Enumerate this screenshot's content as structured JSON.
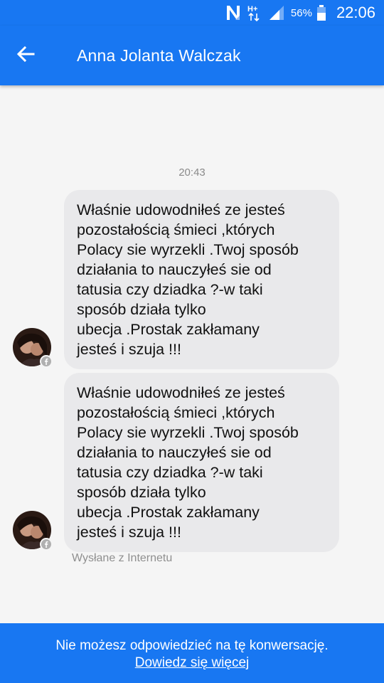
{
  "status_bar": {
    "carrier_icon": "n-icon",
    "network_label": "H+",
    "battery_percent": "56%",
    "time": "22:06"
  },
  "header": {
    "back_icon": "arrow-back-icon",
    "title": "Anna Jolanta Walczak"
  },
  "conversation": {
    "timestamp": "20:43",
    "messages": [
      {
        "text": "Właśnie udowodniłeś ze jesteś\npozostałością śmieci ,których\nPolacy sie wyrzekli .Twoj sposób\ndziałania to nauczyłeś sie od\ntatusia czy dziadka ?-w taki\nsposób działa tylko\nubecja .Prostak zakłamany\njesteś i szuja !!!"
      },
      {
        "text": "Właśnie udowodniłeś ze jesteś\npozostałością śmieci ,których\nPolacy sie wyrzekli .Twoj sposób\ndziałania to nauczyłeś sie od\ntatusia czy dziadka ?-w taki\nsposób działa tylko\nubecja .Prostak zakłamany\njesteś i szuja !!!"
      }
    ],
    "sent_from": "Wysłane z Internetu"
  },
  "footer": {
    "notice": "Nie możesz odpowiedzieć na tę konwersację.",
    "learn_more": "Dowiedz się więcej"
  },
  "colors": {
    "brand_blue": "#1877f2",
    "bubble_gray": "#e9e9eb",
    "background": "#f5f5f5"
  }
}
